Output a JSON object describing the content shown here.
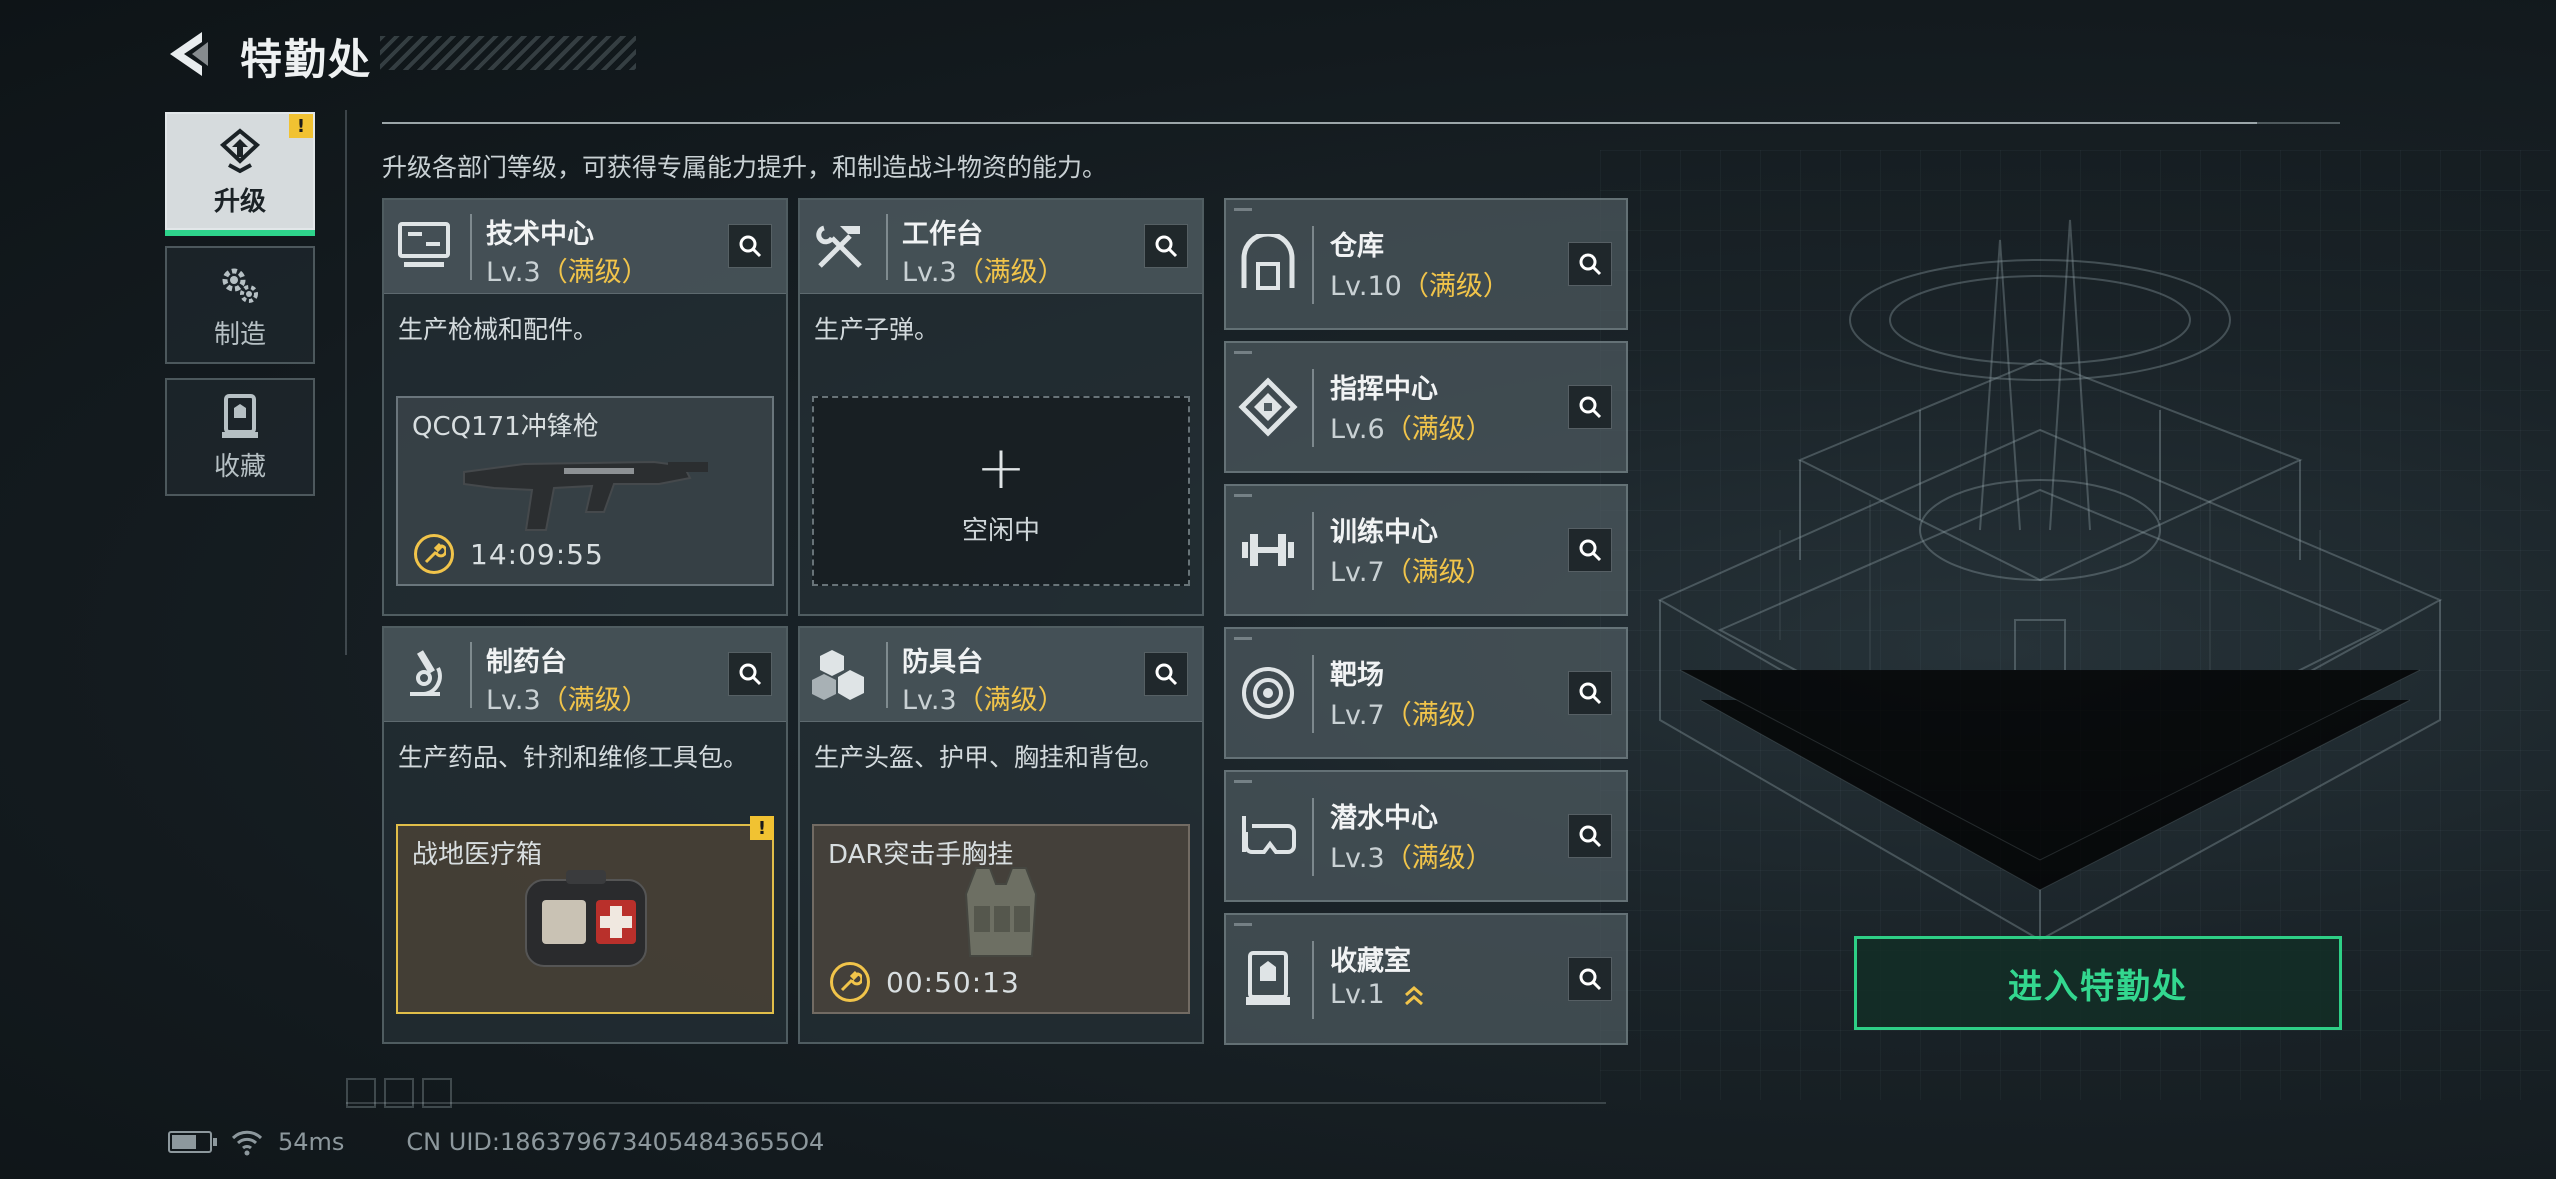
{
  "header": {
    "title": "特勤处"
  },
  "sidebar": {
    "tabs": [
      {
        "label": "升级",
        "active": true,
        "alert": "!"
      },
      {
        "label": "制造",
        "active": false
      },
      {
        "label": "收藏",
        "active": false
      }
    ]
  },
  "description": "升级各部门等级，可获得专属能力提升，和制造战斗物资的能力。",
  "departments": [
    {
      "name": "技术中心",
      "level": "Lv.3",
      "max_label": "（满级）",
      "desc": "生产枪械和配件。",
      "slot": {
        "item": "QCQ171冲锋枪",
        "timer": "14:09:55"
      }
    },
    {
      "name": "工作台",
      "level": "Lv.3",
      "max_label": "（满级）",
      "desc": "生产子弹。",
      "slot": {
        "plus": "+",
        "empty_text": "空闲中"
      }
    },
    {
      "name": "制药台",
      "level": "Lv.3",
      "max_label": "（满级）",
      "desc": "生产药品、针剂和维修工具包。",
      "slot": {
        "item": "战地医疗箱",
        "alert": "!"
      }
    },
    {
      "name": "防具台",
      "level": "Lv.3",
      "max_label": "（满级）",
      "desc": "生产头盔、护甲、胸挂和背包。",
      "slot": {
        "item": "DAR突击手胸挂",
        "timer": "00:50:13"
      }
    }
  ],
  "facilities": [
    {
      "name": "仓库",
      "level": "Lv.10",
      "max_label": "（满级）"
    },
    {
      "name": "指挥中心",
      "level": "Lv.6",
      "max_label": "（满级）"
    },
    {
      "name": "训练中心",
      "level": "Lv.7",
      "max_label": "（满级）"
    },
    {
      "name": "靶场",
      "level": "Lv.7",
      "max_label": "（满级）"
    },
    {
      "name": "潜水中心",
      "level": "Lv.3",
      "max_label": "（满级）"
    },
    {
      "name": "收藏室",
      "level": "Lv.1",
      "upgrade_available": true
    }
  ],
  "enter_button": "进入特勤处",
  "status": {
    "ping": "54ms",
    "uid": "CN UID:1863796734054843655O4"
  },
  "colors": {
    "accent_green": "#2ed38b",
    "max_yellow": "#f1c44a",
    "alert_yellow": "#f1c232"
  }
}
